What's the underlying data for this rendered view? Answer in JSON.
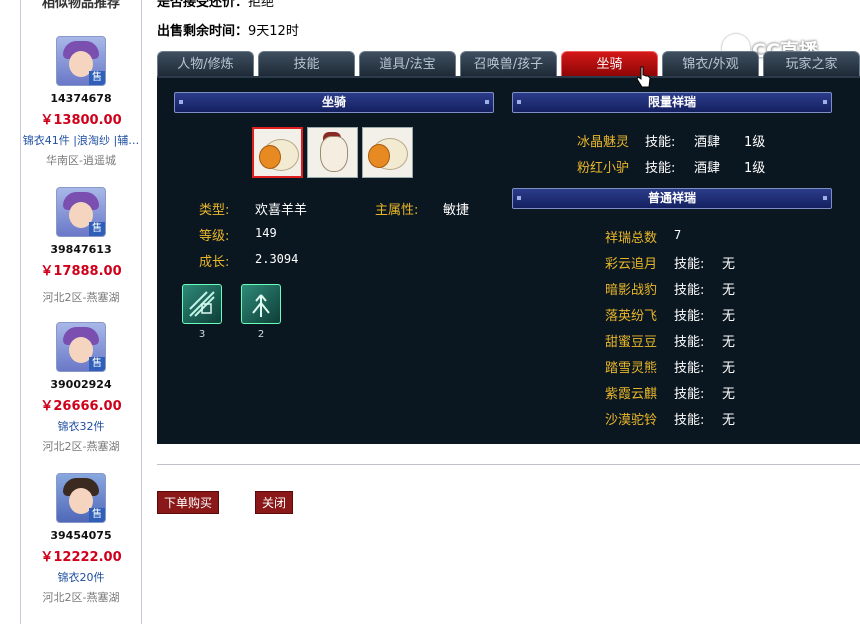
{
  "sidebar": {
    "title": "相似物品推荐",
    "items": [
      {
        "id": "14374678",
        "price": "￥13800.00",
        "extra": "锦衣41件 |浪淘纱 |辅…",
        "server": "华南区-逍遥城",
        "sell": "售"
      },
      {
        "id": "39847613",
        "price": "￥17888.00",
        "extra": "",
        "server": "河北2区-燕塞湖",
        "sell": "售"
      },
      {
        "id": "39002924",
        "price": "￥26666.00",
        "extra": "锦衣32件",
        "server": "河北2区-燕塞湖",
        "sell": "售"
      },
      {
        "id": "39454075",
        "price": "￥12222.00",
        "extra": "锦衣20件",
        "server": "河北2区-燕塞湖",
        "sell": "售"
      }
    ]
  },
  "info": {
    "bargain_label": "是否接受还价：",
    "bargain_value": "拒绝",
    "remain_label": "出售剩余时间：",
    "remain_value": "9天12时"
  },
  "watermark": "CC直播",
  "tabs": [
    {
      "label": "人物/修炼"
    },
    {
      "label": "技能"
    },
    {
      "label": "道具/法宝"
    },
    {
      "label": "召唤兽/孩子"
    },
    {
      "label": "坐骑",
      "active": true
    },
    {
      "label": "锦衣/外观"
    },
    {
      "label": "玩家之家"
    }
  ],
  "mount_section": {
    "title": "坐骑",
    "type_label": "类型:",
    "type_value": "欢喜羊羊",
    "attr_label": "主属性:",
    "attr_value": "敏捷",
    "level_label": "等级:",
    "level_value": "149",
    "growth_label": "成长:",
    "growth_value": "2.3094",
    "skills": [
      {
        "level": "3"
      },
      {
        "level": "2"
      }
    ]
  },
  "limited_section": {
    "title": "限量祥瑞",
    "items": [
      {
        "name": "冰晶魅灵",
        "skill_label": "技能:",
        "skill": "酒肆",
        "level": "1级"
      },
      {
        "name": "粉红小驴",
        "skill_label": "技能:",
        "skill": "酒肆",
        "level": "1级"
      }
    ]
  },
  "normal_section": {
    "title": "普通祥瑞",
    "total_label": "祥瑞总数",
    "total_value": "7",
    "items": [
      {
        "name": "彩云追月",
        "skill_label": "技能:",
        "skill": "无"
      },
      {
        "name": "暗影战豹",
        "skill_label": "技能:",
        "skill": "无"
      },
      {
        "name": "落英纷飞",
        "skill_label": "技能:",
        "skill": "无"
      },
      {
        "name": "甜蜜豆豆",
        "skill_label": "技能:",
        "skill": "无"
      },
      {
        "name": "踏雪灵熊",
        "skill_label": "技能:",
        "skill": "无"
      },
      {
        "name": "紫霞云麒",
        "skill_label": "技能:",
        "skill": "无"
      },
      {
        "name": "沙漠驼铃",
        "skill_label": "技能:",
        "skill": "无"
      }
    ]
  },
  "buttons": {
    "buy": "下单购买",
    "close": "关闭"
  },
  "colors": {
    "accent_red": "#d0001a",
    "tab_active": "#c01010",
    "panel_bg": "#0b1720",
    "label_yellow": "#e8b62a"
  }
}
